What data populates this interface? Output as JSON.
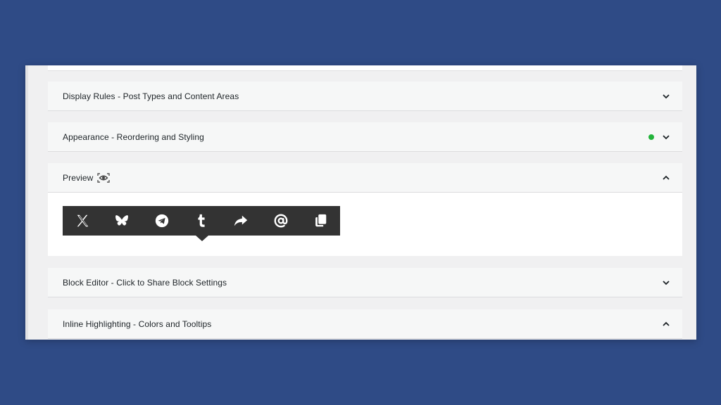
{
  "panels": {
    "display_rules": {
      "title": "Display Rules - Post Types and Content Areas",
      "state": "collapsed"
    },
    "appearance": {
      "title": "Appearance - Reordering and Styling",
      "state": "collapsed",
      "status_color": "#22b33a"
    },
    "preview": {
      "title": "Preview",
      "state": "expanded",
      "title_icon": "eye-scan-icon",
      "toolbar_buttons": [
        {
          "icon": "x-logo-icon"
        },
        {
          "icon": "bluesky-butterfly-icon"
        },
        {
          "icon": "telegram-icon"
        },
        {
          "icon": "tumblr-icon"
        },
        {
          "icon": "share-arrow-icon"
        },
        {
          "icon": "at-email-icon"
        },
        {
          "icon": "copy-icon"
        }
      ]
    },
    "block_editor": {
      "title": "Block Editor - Click to Share Block Settings",
      "state": "collapsed"
    },
    "inline_highlighting": {
      "title": "Inline Highlighting - Colors and Tooltips",
      "state": "expanded"
    }
  },
  "colors": {
    "page_background": "#2f4b86",
    "toolbar_background": "#333333",
    "toolbar_icon": "#ffffff"
  }
}
